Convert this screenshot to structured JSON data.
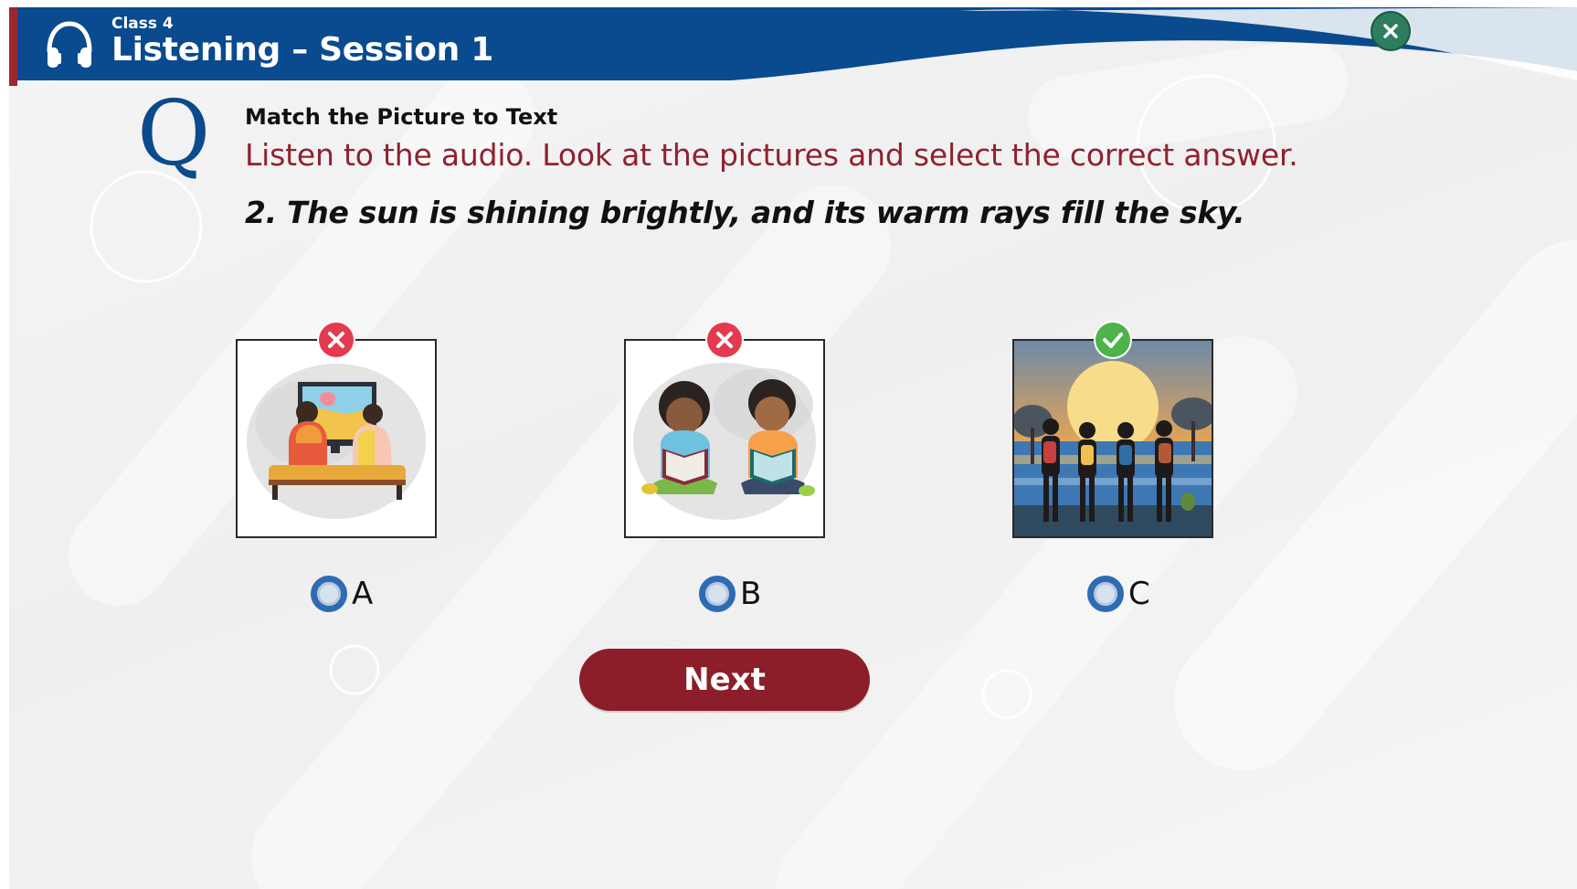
{
  "header": {
    "class_label": "Class 4",
    "title": "Listening – Session 1",
    "icon": "headphones-icon",
    "close_icon": "close-icon",
    "bar_color": "#0a4a8f",
    "accent_color": "#9b2730"
  },
  "question": {
    "badge": "Q",
    "type_label": "Match the Picture to Text",
    "instruction": "Listen to the audio. Look at the pictures and select the correct answer.",
    "sentence": "2. The sun is shining brightly, and its warm rays fill the sky."
  },
  "options": [
    {
      "letter": "A",
      "image": "children-watching-tv-image",
      "result": "incorrect",
      "result_icon": "cross-icon",
      "selected": false
    },
    {
      "letter": "B",
      "image": "children-reading-books-image",
      "result": "incorrect",
      "result_icon": "cross-icon",
      "selected": false
    },
    {
      "letter": "C",
      "image": "friends-watching-sunset-image",
      "result": "correct",
      "result_icon": "check-icon",
      "selected": false
    }
  ],
  "next_button": {
    "label": "Next",
    "color": "#8b1e28"
  },
  "colors": {
    "correct": "#4fb24a",
    "incorrect": "#e23a4f",
    "radio": "#2f6bb3",
    "instruction": "#8e2230"
  }
}
